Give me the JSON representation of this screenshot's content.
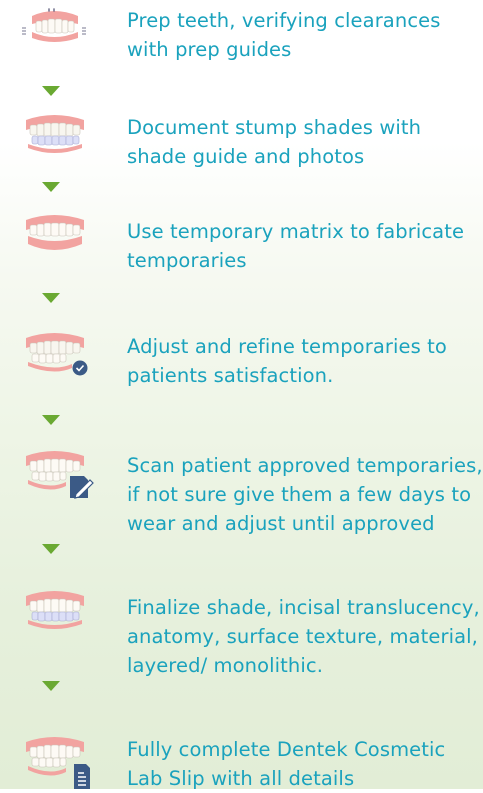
{
  "steps": [
    {
      "text": "Prep teeth, verifying clearances with prep guides",
      "icon": "teeth-with-prep-guides-icon"
    },
    {
      "text": "Document stump shades with shade guide and photos",
      "icon": "teeth-shaded-stumps-icon"
    },
    {
      "text": "Use temporary matrix to fabricate temporaries",
      "icon": "teeth-temporaries-icon"
    },
    {
      "text": "Adjust and refine temporaries to patients satisfaction.",
      "icon": "teeth-check-icon"
    },
    {
      "text": "Scan patient approved temporaries, if not sure give them a few days to wear and adjust until approved",
      "icon": "teeth-scan-edit-icon"
    },
    {
      "text": "Finalize shade, incisal translucency, anatomy, surface texture, material, layered/ monolithic.",
      "icon": "teeth-finalize-icon"
    },
    {
      "text": "Fully complete Dentek Cosmetic Lab Slip with all details",
      "icon": "teeth-lab-slip-icon"
    }
  ],
  "colors": {
    "text": "#1aa2bd",
    "arrow": "#6aa932",
    "gum": "#f4a8a4",
    "badge": "#3b5a86"
  }
}
